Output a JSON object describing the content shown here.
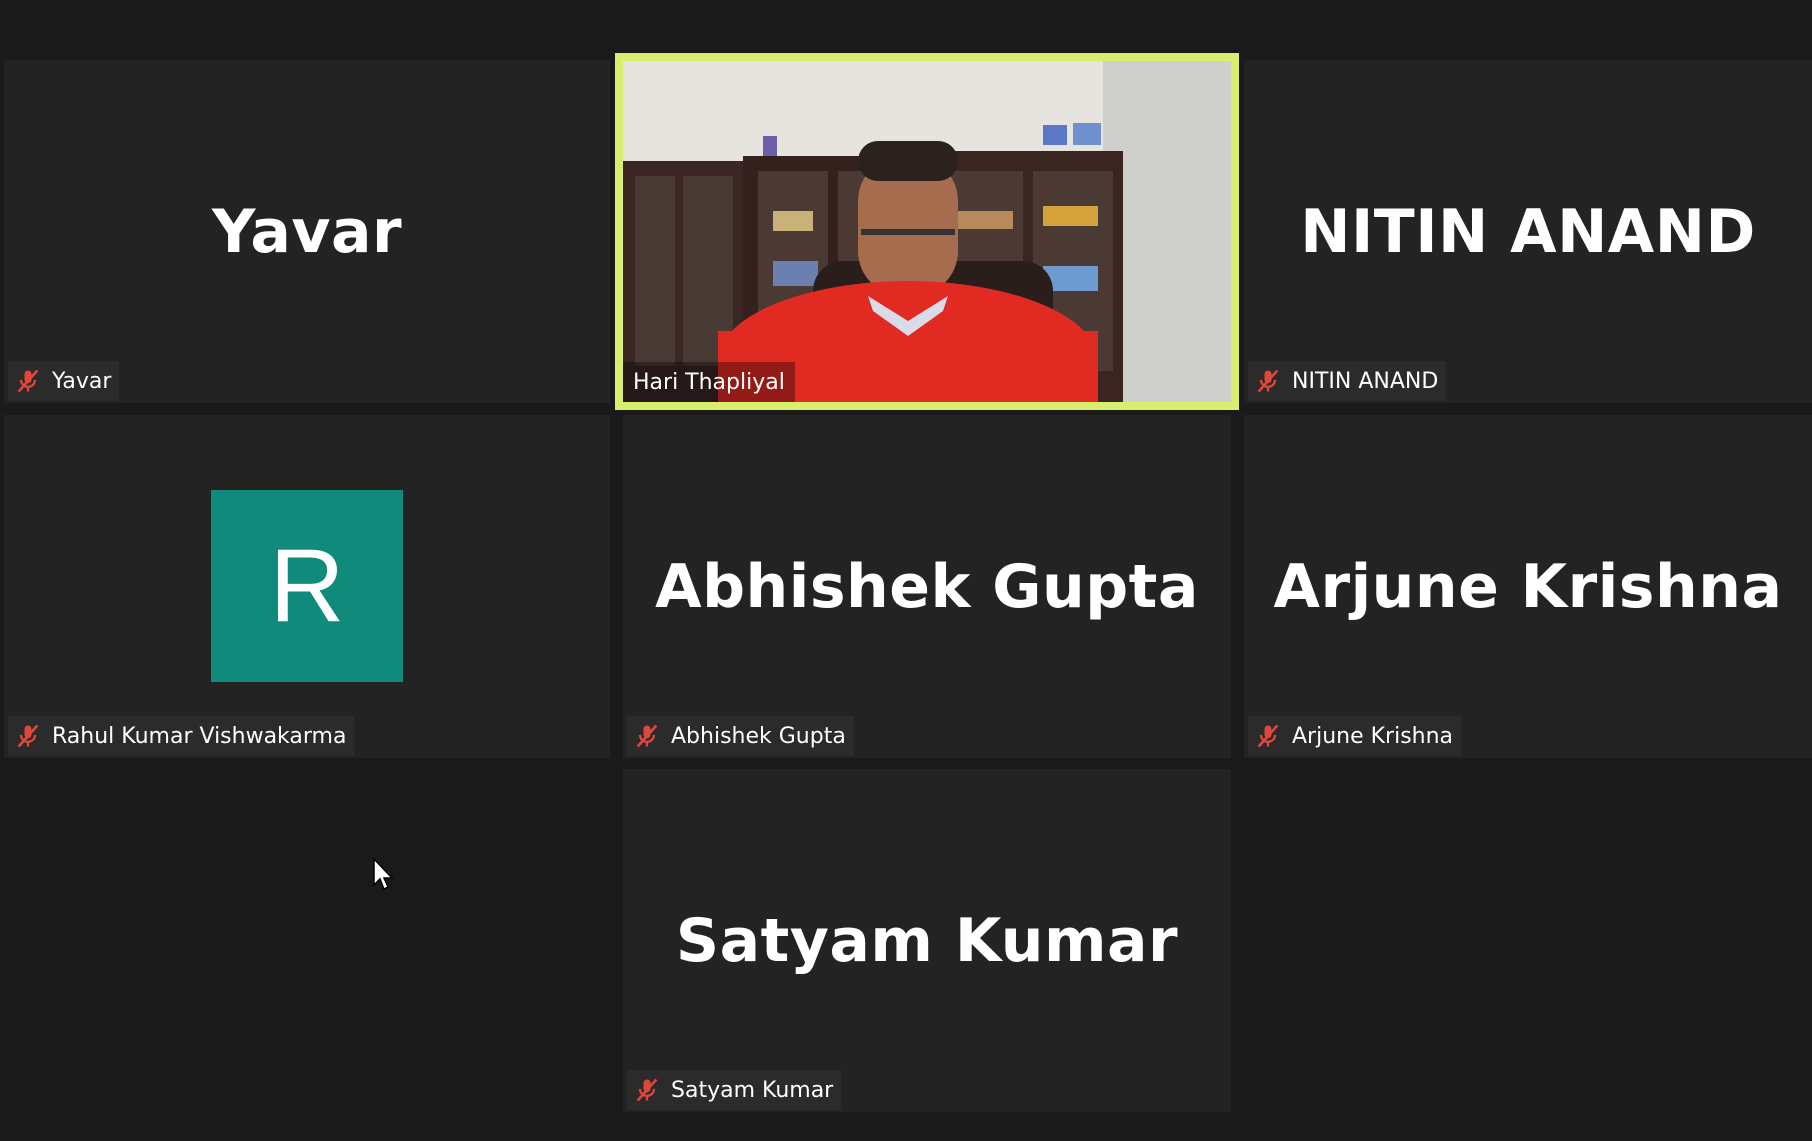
{
  "participants": [
    {
      "name": "Yavar",
      "label": "Yavar",
      "muted": true
    },
    {
      "name": "Hari Thapliyal",
      "label": "Hari Thapliyal",
      "video": true,
      "active_speaker": true
    },
    {
      "name": "NITIN ANAND",
      "label": "NITIN ANAND",
      "muted": true
    },
    {
      "name": "Rahul Kumar Vishwakarma",
      "label": "Rahul Kumar Vishwakarma",
      "avatar_letter": "R",
      "avatar_color": "#0f8a7b",
      "muted": true
    },
    {
      "name": "Abhishek Gupta",
      "label": "Abhishek Gupta",
      "muted": true
    },
    {
      "name": "Arjune Krishna",
      "label": "Arjune Krishna",
      "muted": true
    },
    {
      "name": "Satyam Kumar",
      "label": "Satyam Kumar",
      "muted": true
    }
  ],
  "colors": {
    "background": "#1a1a1a",
    "tile": "#232323",
    "active_border": "#d7ee6f",
    "mute_icon": "#e0473a"
  },
  "icons": {
    "mute": "muted-microphone-icon",
    "cursor": "mouse-pointer-icon"
  }
}
